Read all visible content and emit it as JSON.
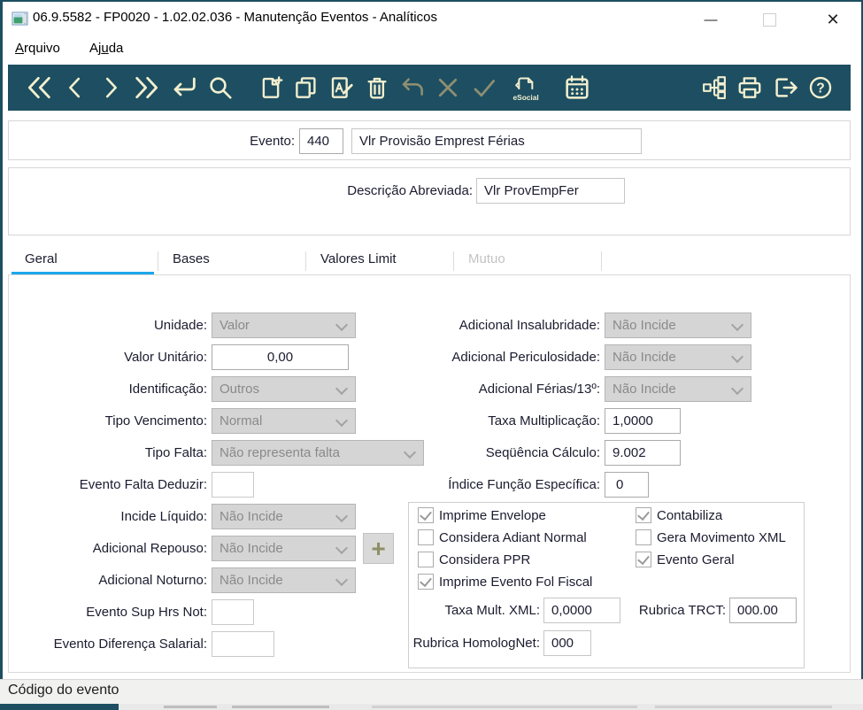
{
  "window": {
    "title": "06.9.5582 - FP0020 - 1.02.02.036 - Manutenção Eventos - Analíticos",
    "minimize_glyph": "—",
    "close_glyph": "✕"
  },
  "menu": {
    "items": [
      {
        "pre": "",
        "accel": "A",
        "rest": "rquivo"
      },
      {
        "pre": "Aj",
        "accel": "u",
        "rest": "da"
      }
    ]
  },
  "toolbar": {
    "esocial_label": "eSocial",
    "help_glyph": "?",
    "icons": [
      "first-record",
      "previous-record",
      "next-record",
      "last-record",
      "enter",
      "search",
      "new-document",
      "copy",
      "edit",
      "delete",
      "undo",
      "cancel",
      "confirm",
      "esocial",
      "calendar",
      "tree",
      "print",
      "exit",
      "help"
    ]
  },
  "header": {
    "evento_label": "Evento:",
    "evento_code": "440",
    "evento_desc": "Vlr Provisão Emprest Férias",
    "desc_label": "Descrição Abreviada:",
    "desc_value": "Vlr ProvEmpFer"
  },
  "tabs": [
    {
      "label": "Geral",
      "active": true
    },
    {
      "label": "Bases"
    },
    {
      "label": "Valores Limit"
    },
    {
      "label": "Mutuo",
      "disabled": true
    }
  ],
  "form": {
    "left": [
      {
        "label": "Unidade:",
        "value": "Valor"
      },
      {
        "label": "Valor Unitário:",
        "value": "0,00"
      },
      {
        "label": "Identificação:",
        "value": "Outros"
      },
      {
        "label": "Tipo Vencimento:",
        "value": "Normal"
      },
      {
        "label": "Tipo Falta:",
        "value": "Não representa falta"
      },
      {
        "label": "Evento Falta Deduzir:",
        "value": ""
      },
      {
        "label": "Incide Líquido:",
        "value": "Não Incide"
      },
      {
        "label": "Adicional Repouso:",
        "value": "Não Incide"
      },
      {
        "label": "Adicional Noturno:",
        "value": "Não Incide"
      },
      {
        "label": "Evento Sup Hrs Not:",
        "value": ""
      },
      {
        "label": "Evento Diferença Salarial:",
        "value": ""
      }
    ],
    "right": [
      {
        "label": "Adicional Insalubridade:",
        "value": "Não Incide"
      },
      {
        "label": "Adicional Periculosidade:",
        "value": "Não Incide"
      },
      {
        "label": "Adicional Férias/13º:",
        "value": "Não Incide"
      },
      {
        "label": "Taxa Multiplicação:",
        "value": "1,0000"
      },
      {
        "label": "Seqüência Cálculo:",
        "value": "9.002"
      },
      {
        "label": "Índice Função Específica:",
        "value": "0"
      }
    ],
    "checkboxes": [
      {
        "label": "Imprime Envelope",
        "checked": true
      },
      {
        "label": "Considera Adiant Normal",
        "checked": false
      },
      {
        "label": "Considera PPR",
        "checked": false
      },
      {
        "label": "Imprime Evento Fol Fiscal",
        "checked": true
      },
      {
        "label": "Contabiliza",
        "checked": true
      },
      {
        "label": "Gera Movimento XML",
        "checked": false
      },
      {
        "label": "Evento Geral",
        "checked": true
      }
    ],
    "group_fields": [
      {
        "label": "Taxa Mult. XML:",
        "value": "0,0000"
      },
      {
        "label": "Rubrica TRCT:",
        "value": "000.00"
      },
      {
        "label": "Rubrica HomologNet:",
        "value": "000"
      }
    ],
    "plus_button": "+"
  },
  "statusbar": {
    "text": "Código do evento"
  },
  "colors": {
    "toolbar_bg": "#1d4e61",
    "icon": "#f2efcf",
    "icon_disabled": "#8e8e72",
    "tab_active_underline": "#1ca6ea",
    "disabled_field_bg": "#d5d5d5"
  }
}
